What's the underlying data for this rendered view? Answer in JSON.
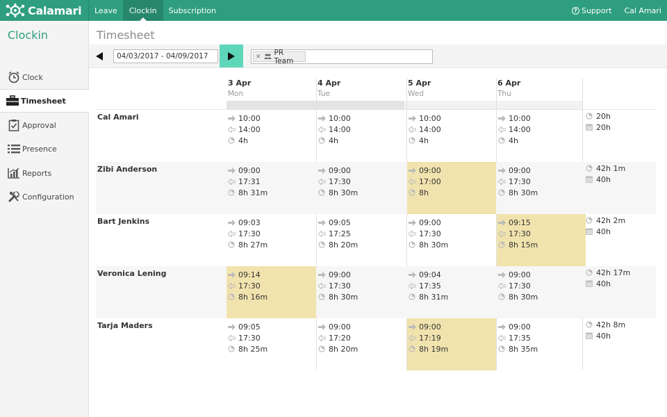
{
  "app": {
    "logo_text": "Calamari"
  },
  "topnav": [
    {
      "label": "Leave",
      "active": false
    },
    {
      "label": "Clockin",
      "active": true
    },
    {
      "label": "Subscription",
      "active": false
    }
  ],
  "topright": {
    "support_label": "Support",
    "user_name": "Cal Amari"
  },
  "sidebar": {
    "title": "Clockin",
    "items": [
      {
        "label": "Clock",
        "icon": "clock-icon",
        "active": false
      },
      {
        "label": "Timesheet",
        "icon": "briefcase-icon",
        "active": true
      },
      {
        "label": "Approval",
        "icon": "clipboard-check-icon",
        "active": false
      },
      {
        "label": "Presence",
        "icon": "list-icon",
        "active": false
      },
      {
        "label": "Reports",
        "icon": "chart-icon",
        "active": false
      },
      {
        "label": "Configuration",
        "icon": "wrench-icon",
        "active": false
      }
    ]
  },
  "main": {
    "title": "Timesheet"
  },
  "toolbar": {
    "date_range": "04/03/2017 - 04/09/2017",
    "filter_tag": "PR Team"
  },
  "days": [
    {
      "date": "3 Apr",
      "name": "Mon"
    },
    {
      "date": "4 Apr",
      "name": "Tue"
    },
    {
      "date": "5 Apr",
      "name": "Wed"
    },
    {
      "date": "6 Apr",
      "name": "Thu"
    }
  ],
  "week_progress": 0.5,
  "rows": [
    {
      "name": "Cal Amari",
      "cells": [
        {
          "in": "10:00",
          "out": "14:00",
          "dur": "4h",
          "highlight": false
        },
        {
          "in": "10:00",
          "out": "14:00",
          "dur": "4h",
          "highlight": false
        },
        {
          "in": "10:00",
          "out": "14:00",
          "dur": "4h",
          "highlight": false
        },
        {
          "in": "10:00",
          "out": "14:00",
          "dur": "4h",
          "highlight": false
        }
      ],
      "total_worked": "20h",
      "total_planned": "20h"
    },
    {
      "name": "Zibi Anderson",
      "cells": [
        {
          "in": "09:00",
          "out": "17:31",
          "dur": "8h 31m",
          "highlight": false
        },
        {
          "in": "09:00",
          "out": "17:30",
          "dur": "8h 30m",
          "highlight": false
        },
        {
          "in": "09:00",
          "out": "17:00",
          "dur": "8h",
          "highlight": true
        },
        {
          "in": "09:00",
          "out": "17:30",
          "dur": "8h 30m",
          "highlight": false
        }
      ],
      "total_worked": "42h 1m",
      "total_planned": "40h"
    },
    {
      "name": "Bart Jenkins",
      "cells": [
        {
          "in": "09:03",
          "out": "17:30",
          "dur": "8h 27m",
          "highlight": false
        },
        {
          "in": "09:05",
          "out": "17:25",
          "dur": "8h 20m",
          "highlight": false
        },
        {
          "in": "09:00",
          "out": "17:30",
          "dur": "8h 30m",
          "highlight": false
        },
        {
          "in": "09:15",
          "out": "17:30",
          "dur": "8h 15m",
          "highlight": true
        }
      ],
      "total_worked": "42h 2m",
      "total_planned": "40h"
    },
    {
      "name": "Veronica Lening",
      "cells": [
        {
          "in": "09:14",
          "out": "17:30",
          "dur": "8h 16m",
          "highlight": true
        },
        {
          "in": "09:00",
          "out": "17:30",
          "dur": "8h 30m",
          "highlight": false
        },
        {
          "in": "09:04",
          "out": "17:35",
          "dur": "8h 31m",
          "highlight": false
        },
        {
          "in": "09:00",
          "out": "17:30",
          "dur": "8h 30m",
          "highlight": false
        }
      ],
      "total_worked": "42h 17m",
      "total_planned": "40h"
    },
    {
      "name": "Tarja Maders",
      "cells": [
        {
          "in": "09:05",
          "out": "17:30",
          "dur": "8h 25m",
          "highlight": false
        },
        {
          "in": "09:00",
          "out": "17:20",
          "dur": "8h 20m",
          "highlight": false
        },
        {
          "in": "09:00",
          "out": "17:19",
          "dur": "8h 19m",
          "highlight": true
        },
        {
          "in": "09:00",
          "out": "17:35",
          "dur": "8h 35m",
          "highlight": false
        }
      ],
      "total_worked": "42h 8m",
      "total_planned": "40h"
    }
  ],
  "colors": {
    "brand": "#2e9e7e",
    "accent": "#5dd6b9",
    "late_highlight": "#f1e3ae"
  }
}
